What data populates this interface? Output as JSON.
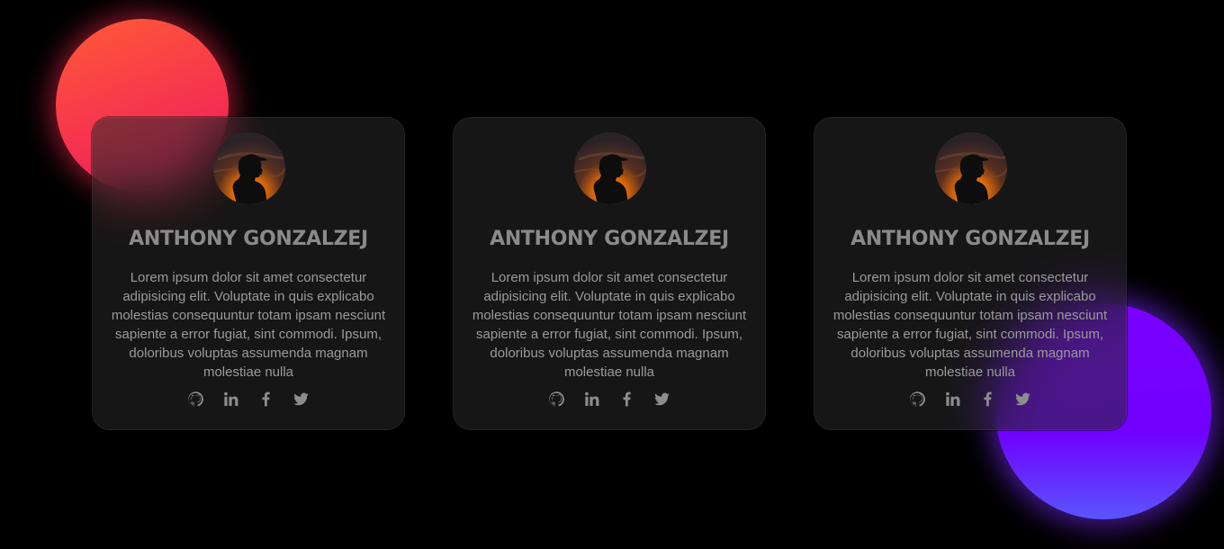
{
  "colors": {
    "background": "#000000",
    "orb_red": "#f6344e",
    "orb_purple": "#7000ff",
    "card_text": "#9a9a9a",
    "icon": "#8d8d8d"
  },
  "cards": [
    {
      "name": "ANTHONY GONZALZEJ",
      "bio": "Lorem ipsum dolor sit amet consectetur adipisicing elit. Voluptate in quis explicabo molestias consequuntur totam ipsam nesciunt sapiente a error fugiat, sint commodi. Ipsum, doloribus voluptas assumenda magnam molestiae nulla",
      "socials": [
        "github-icon",
        "linkedin-icon",
        "facebook-icon",
        "twitter-icon"
      ]
    },
    {
      "name": "ANTHONY GONZALZEJ",
      "bio": "Lorem ipsum dolor sit amet consectetur adipisicing elit. Voluptate in quis explicabo molestias consequuntur totam ipsam nesciunt sapiente a error fugiat, sint commodi. Ipsum, doloribus voluptas assumenda magnam molestiae nulla",
      "socials": [
        "github-icon",
        "linkedin-icon",
        "facebook-icon",
        "twitter-icon"
      ]
    },
    {
      "name": "ANTHONY GONZALZEJ",
      "bio": "Lorem ipsum dolor sit amet consectetur adipisicing elit. Voluptate in quis explicabo molestias consequuntur totam ipsam nesciunt sapiente a error fugiat, sint commodi. Ipsum, doloribus voluptas assumenda magnam molestiae nulla",
      "socials": [
        "github-icon",
        "linkedin-icon",
        "facebook-icon",
        "twitter-icon"
      ]
    }
  ]
}
